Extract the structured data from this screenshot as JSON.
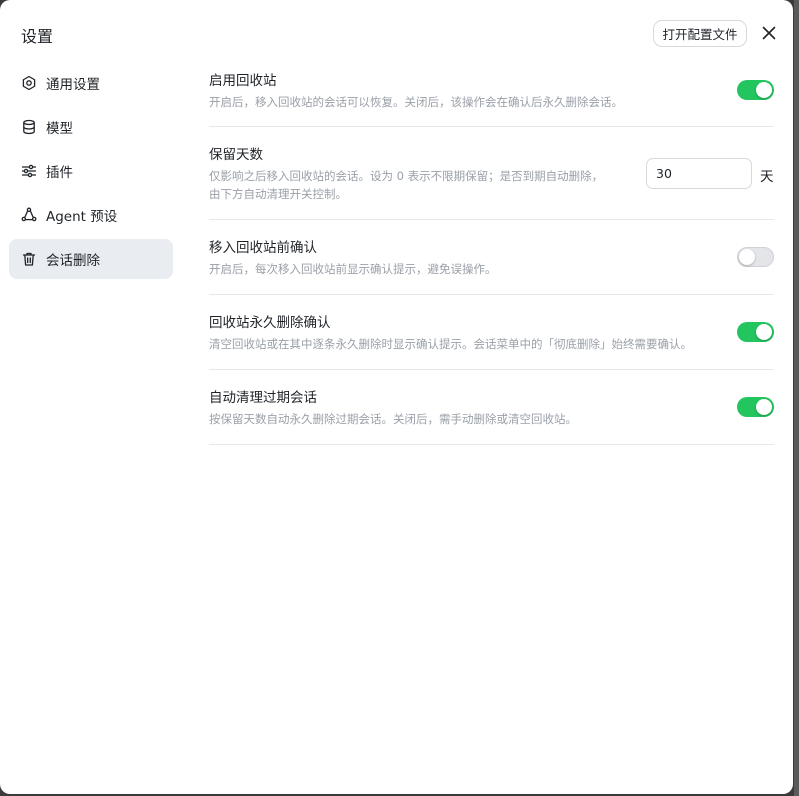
{
  "dialog": {
    "title": "设置",
    "open_config_label": "打开配置文件",
    "close_icon": "close-icon"
  },
  "sidebar": {
    "items": [
      {
        "label": "通用设置",
        "icon": "gear-icon",
        "active": false
      },
      {
        "label": "模型",
        "icon": "database-icon",
        "active": false
      },
      {
        "label": "插件",
        "icon": "sliders-icon",
        "active": false
      },
      {
        "label": "Agent 预设",
        "icon": "agent-icon",
        "active": false
      },
      {
        "label": "会话删除",
        "icon": "trash-icon",
        "active": true
      }
    ]
  },
  "settings": [
    {
      "title": "启用回收站",
      "desc": "开启后，移入回收站的会话可以恢复。关闭后，该操作会在确认后永久删除会话。",
      "toggle": true
    },
    {
      "title": "保留天数",
      "desc_line1": "仅影响之后移入回收站的会话。设为 0 表示不限期保留；是否到期自动删除，",
      "desc_line2": "由下方自动清理开关控制。",
      "value": "30",
      "unit": "天"
    },
    {
      "title": "移入回收站前确认",
      "desc": "开启后，每次移入回收站前显示确认提示，避免误操作。",
      "toggle": false
    },
    {
      "title": "回收站永久删除确认",
      "desc": "清空回收站或在其中逐条永久删除时显示确认提示。会话菜单中的「彻底删除」始终需要确认。",
      "toggle": true
    },
    {
      "title": "自动清理过期会话",
      "desc": "按保留天数自动永久删除过期会话。关闭后，需手动删除或清空回收站。",
      "toggle": true
    }
  ],
  "colors": {
    "toggle_on": "#22c55e",
    "toggle_off": "#e3e5e8",
    "active_nav": "#e9ecf0"
  }
}
